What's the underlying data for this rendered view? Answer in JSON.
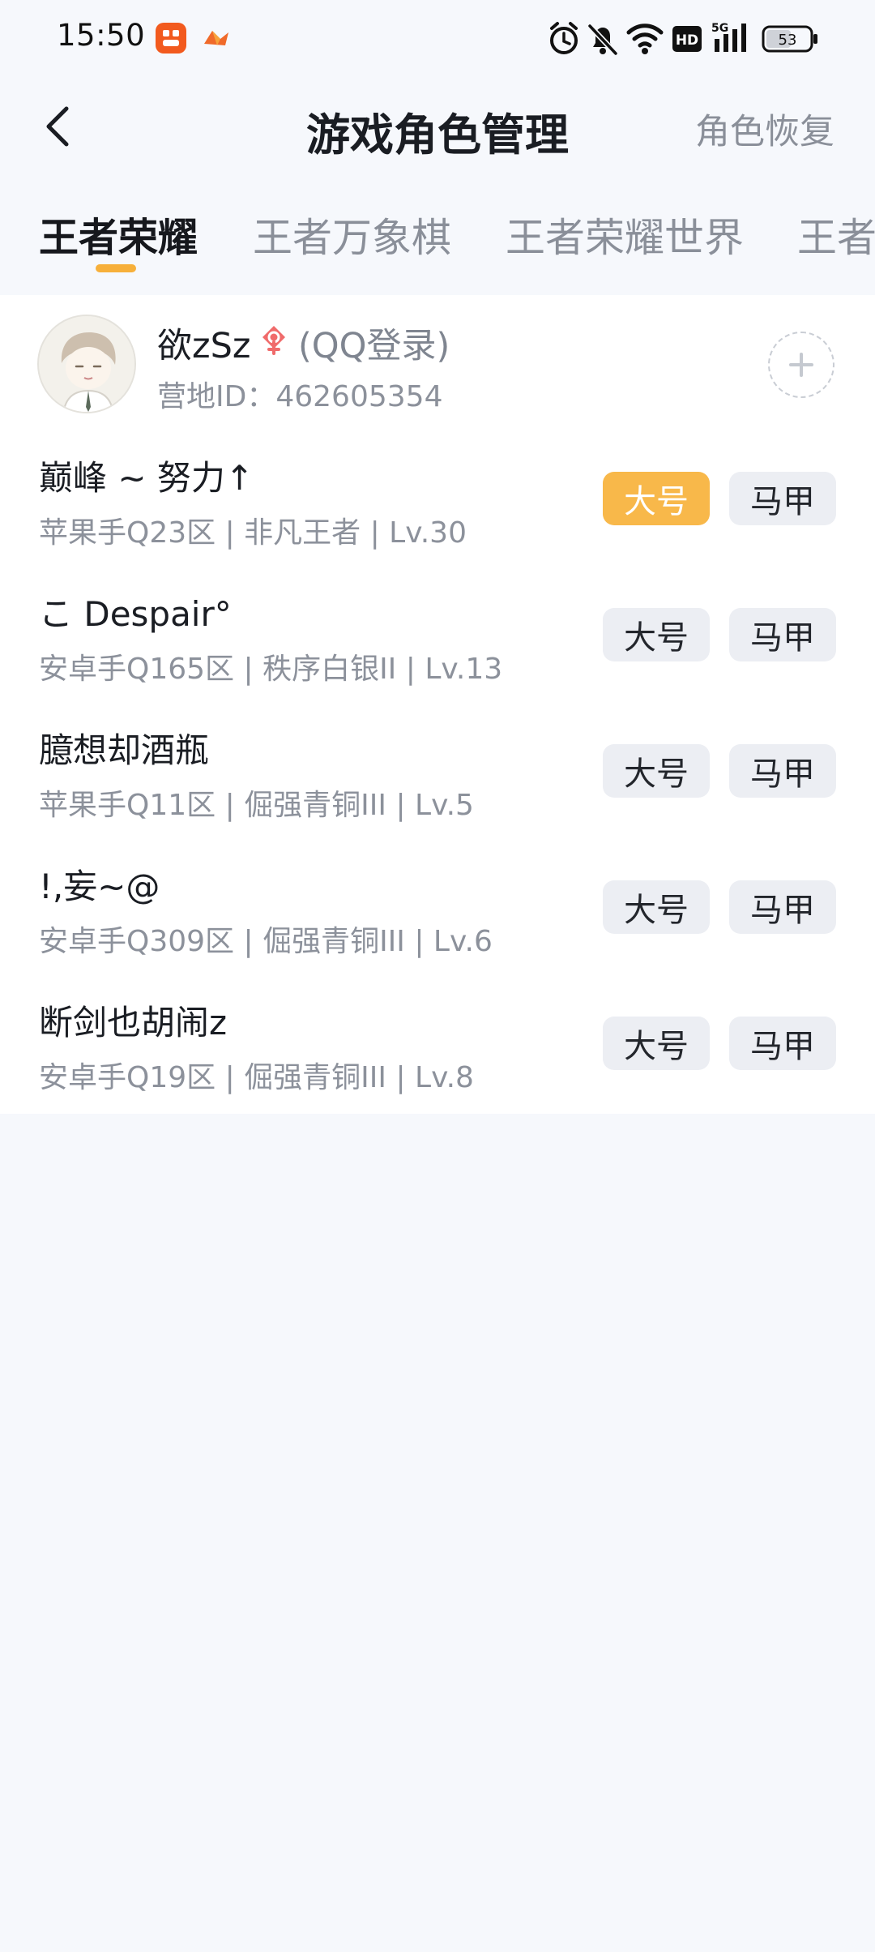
{
  "status_bar": {
    "time": "15:50",
    "battery": "53",
    "network": "5G",
    "hd_label": "HD",
    "icons": [
      "app-notification-icon",
      "app-notification-icon-2",
      "alarm-icon",
      "mute-icon",
      "wifi-icon",
      "hd-icon",
      "signal-icon",
      "battery-icon"
    ]
  },
  "header": {
    "title": "游戏角色管理",
    "restore_label": "角色恢复",
    "back_icon": "back-arrow-icon"
  },
  "tabs": [
    {
      "label": "王者荣耀",
      "active": true
    },
    {
      "label": "王者万象棋",
      "active": false
    },
    {
      "label": "王者荣耀世界",
      "active": false
    },
    {
      "label": "王者",
      "active": false
    }
  ],
  "account": {
    "name": "欲zSz",
    "login_type": "(QQ登录)",
    "camp_id": "营地ID：462605354",
    "gender_icon": "female-gender-icon",
    "add_icon": "plus-icon"
  },
  "roles": [
    {
      "name": "巅峰 ~ 努力↑",
      "info": "苹果手Q23区 | 非凡王者 | Lv.30",
      "main_label": "大号",
      "alt_label": "马甲",
      "selected": "main"
    },
    {
      "name": "こ Despair°",
      "info": "安卓手Q165区 | 秩序白银II | Lv.13",
      "main_label": "大号",
      "alt_label": "马甲",
      "selected": ""
    },
    {
      "name": "臆想却酒瓶",
      "info": "苹果手Q11区 | 倔强青铜III | Lv.5",
      "main_label": "大号",
      "alt_label": "马甲",
      "selected": ""
    },
    {
      "name": "!,妄~@",
      "info": "安卓手Q309区 | 倔强青铜III | Lv.6",
      "main_label": "大号",
      "alt_label": "马甲",
      "selected": ""
    },
    {
      "name": "断剑也胡闹z",
      "info": "安卓手Q19区 | 倔强青铜III | Lv.8",
      "main_label": "大号",
      "alt_label": "马甲",
      "selected": ""
    }
  ],
  "colors": {
    "accent": "#f8b84a",
    "indicator": "#f7b03a",
    "page_bg": "#f6f8fc",
    "card_bg": "#ffffff"
  }
}
